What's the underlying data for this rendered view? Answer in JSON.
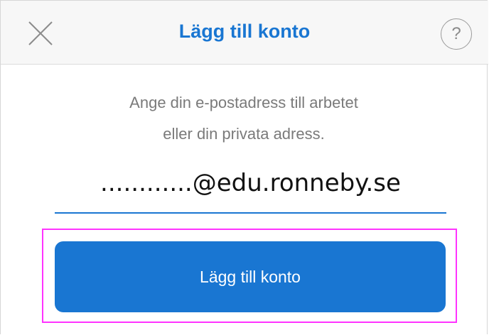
{
  "header": {
    "title": "Lägg till konto",
    "close_icon": "close-icon",
    "help_label": "?"
  },
  "main": {
    "instruction_line1": "Ange din e-postadress till arbetet",
    "instruction_line2": "eller din privata adress.",
    "email_value": "............@edu.ronneby.se",
    "add_button_label": "Lägg till konto"
  },
  "colors": {
    "accent": "#1976d2",
    "highlight": "#ff33ff",
    "instruction_text": "#7a7a7a"
  }
}
